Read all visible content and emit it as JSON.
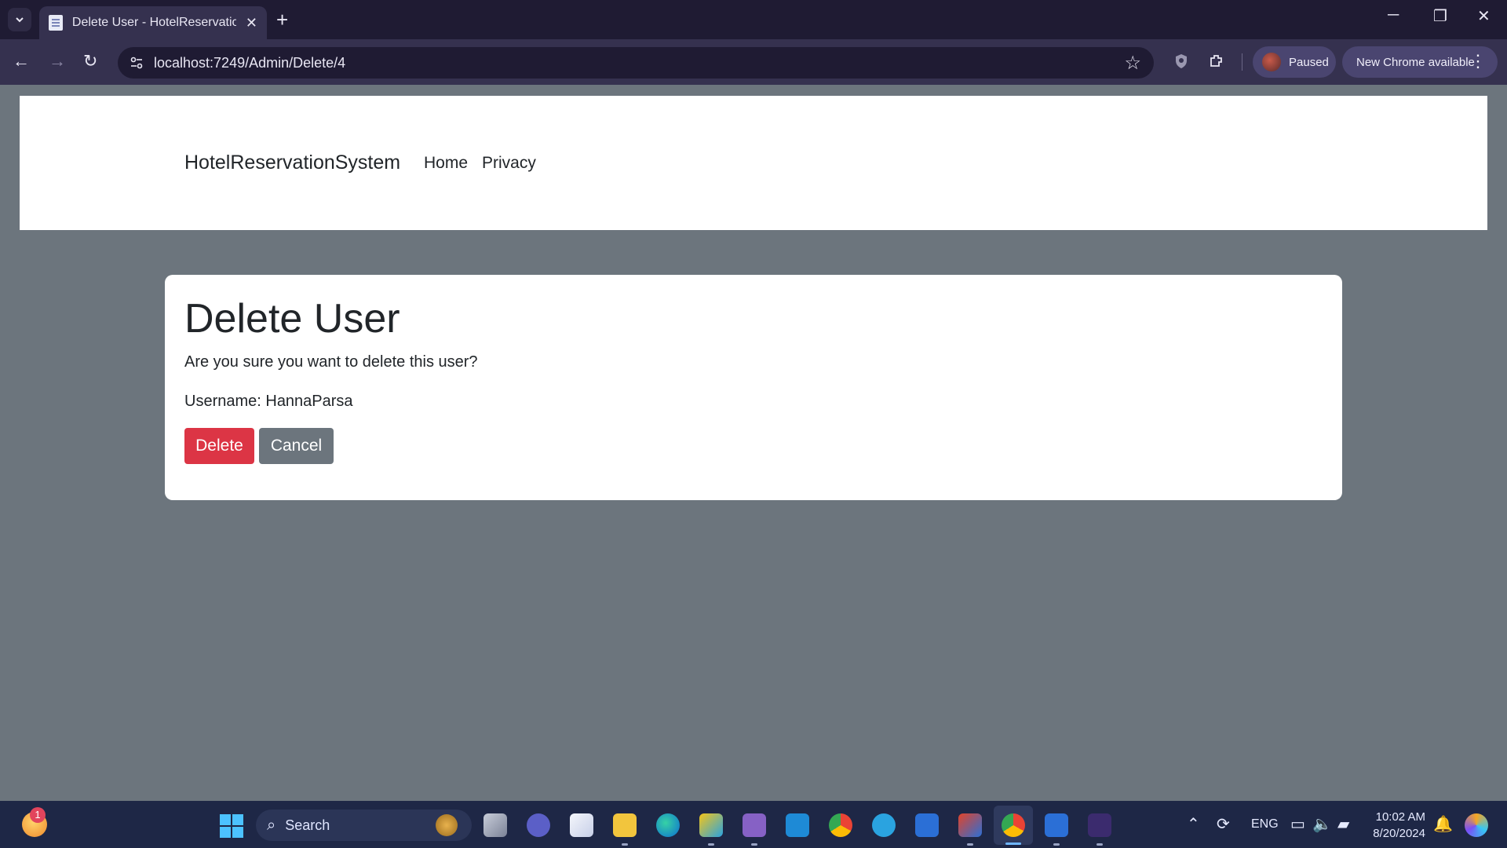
{
  "browser": {
    "tab_title": "Delete User - HotelReservationSystem",
    "url": "localhost:7249/Admin/Delete/4",
    "profile_status": "Paused",
    "update_label": "New Chrome available"
  },
  "navbar": {
    "brand": "HotelReservationSystem",
    "links": [
      "Home",
      "Privacy"
    ]
  },
  "card": {
    "title": "Delete User",
    "question": "Are you sure you want to delete this user?",
    "username_line": "Username: HannaParsa",
    "delete_label": "Delete",
    "cancel_label": "Cancel"
  },
  "colors": {
    "page_background": "#6c757d",
    "danger": "#dc3545",
    "secondary": "#6c757d"
  },
  "taskbar": {
    "weather_badge": "1",
    "search_label": "Search",
    "language": "ENG",
    "time": "10:02 AM",
    "date": "8/20/2024",
    "apps": [
      "task-view",
      "teams",
      "store",
      "file-explorer",
      "edge",
      "photo-editor",
      "visual-studio",
      "vs-code",
      "chrome",
      "telegram",
      "defender",
      "git",
      "chrome",
      "defender",
      "terminal"
    ]
  }
}
